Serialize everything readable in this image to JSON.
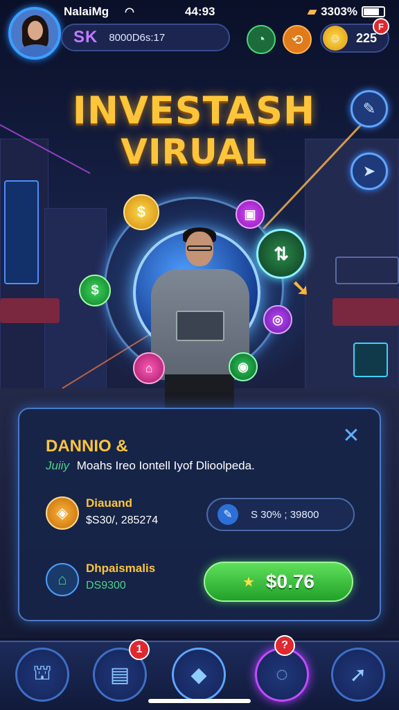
{
  "status_bar": {
    "carrier": "NalaiMg",
    "time": "44:93",
    "battery": "3303%"
  },
  "profile": {
    "level_badge": "SK",
    "player_id": "8000D6s:17"
  },
  "currency": {
    "value": "225",
    "notification_badge": "F"
  },
  "title": {
    "line1": "INVESTASH",
    "line2": "VIRUAL"
  },
  "panel": {
    "title": "DANNIO &",
    "desc_highlight": "Juiiy",
    "desc_text": "Moahs Ireo Iontell Iyof Dlioolpeda.",
    "row1_label": "Diauand",
    "row1_value": "$S30/, 285274",
    "input_text": "S 30% ; 39800",
    "row2_label": "Dhpaismalis",
    "row2_value": "DS9300",
    "button_amount": "$0.76",
    "close_symbol": "✕"
  },
  "bottom_nav": {
    "badge_1": "1",
    "badge_2": "?"
  },
  "icons": {
    "signal": "wifi-icon",
    "top_icons": [
      "green-chart-icon",
      "orange-swap-icon",
      "gold-coin-icon"
    ],
    "side": [
      "feather-icon",
      "arrow-icon"
    ],
    "nav": [
      "bank-icon",
      "wallet-icon",
      "home-crystal-icon",
      "target-icon",
      "growth-arrow-icon"
    ]
  },
  "colors": {
    "accent_gold": "#ffc53a",
    "accent_blue": "#3aa0ff",
    "button_green": "#2fbf3a",
    "badge_red": "#e0282e"
  }
}
